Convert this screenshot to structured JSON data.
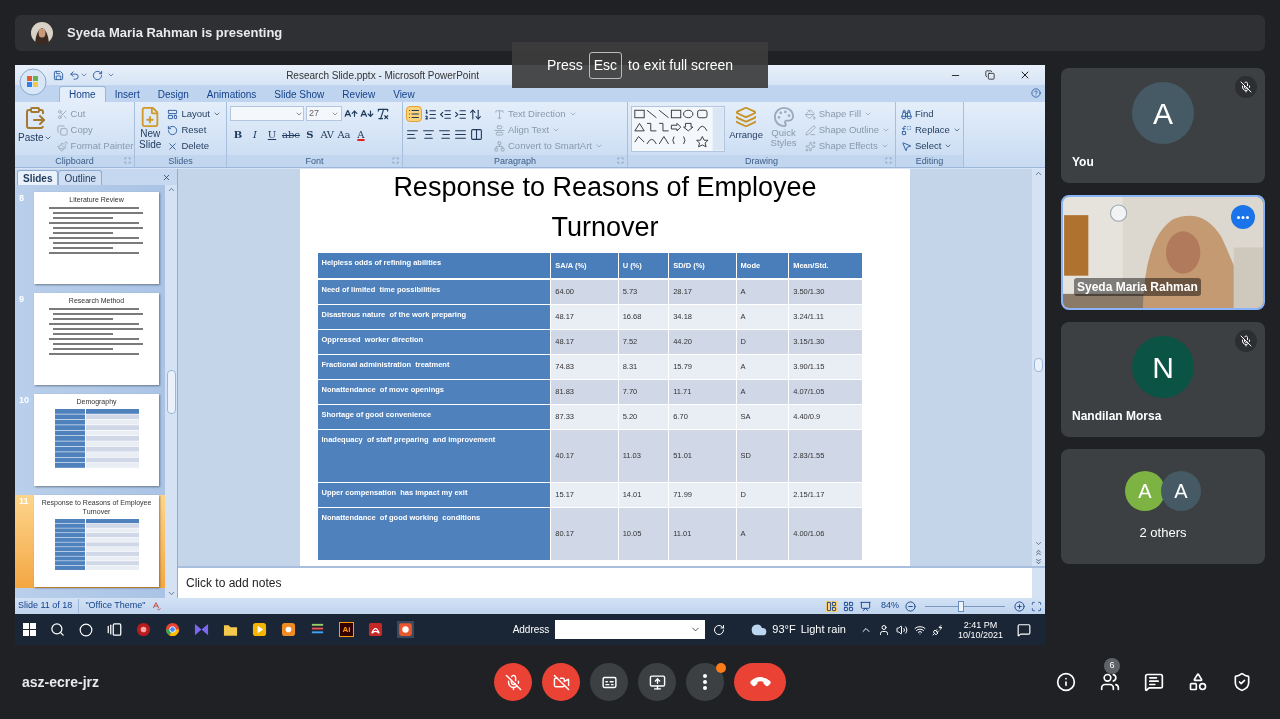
{
  "presenting_banner": {
    "text": "Syeda Maria Rahman is presenting"
  },
  "fullscreen_hint": {
    "before": "Press",
    "key": "Esc",
    "after": "to exit full screen"
  },
  "powerpoint": {
    "title": "Research Slide.pptx - Microsoft PowerPoint",
    "ribbon_tabs": [
      {
        "label": "Home",
        "selected": true
      },
      {
        "label": "Insert",
        "selected": false
      },
      {
        "label": "Design",
        "selected": false
      },
      {
        "label": "Animations",
        "selected": false
      },
      {
        "label": "Slide Show",
        "selected": false
      },
      {
        "label": "Review",
        "selected": false
      },
      {
        "label": "View",
        "selected": false
      }
    ],
    "clipboard": {
      "label": "Clipboard",
      "paste": "Paste",
      "items": [
        {
          "label": "Cut",
          "disabled": true
        },
        {
          "label": "Copy",
          "disabled": true
        },
        {
          "label": "Format Painter",
          "disabled": true
        }
      ]
    },
    "slides_group": {
      "label": "Slides",
      "new_slide": "New Slide",
      "items": [
        {
          "label": "Layout",
          "disabled": false
        },
        {
          "label": "Reset",
          "disabled": false
        },
        {
          "label": "Delete",
          "disabled": false
        }
      ]
    },
    "font": {
      "label": "Font",
      "size": "27",
      "format_buttons": [
        "B",
        "I",
        "U",
        "abc",
        "S",
        "AV",
        "Aa",
        "A"
      ]
    },
    "paragraph": {
      "label": "Paragraph",
      "bullets_on": true,
      "items": [
        {
          "label": "Text Direction",
          "disabled": true
        },
        {
          "label": "Align Text",
          "disabled": true
        },
        {
          "label": "Convert to SmartArt",
          "disabled": true
        }
      ]
    },
    "drawing": {
      "label": "Drawing",
      "arrange": "Arrange",
      "quick_styles": "Quick Styles",
      "quick_styles_disabled": true,
      "items": [
        {
          "label": "Shape Fill",
          "disabled": true
        },
        {
          "label": "Shape Outline",
          "disabled": true
        },
        {
          "label": "Shape Effects",
          "disabled": true
        }
      ]
    },
    "editing": {
      "label": "Editing",
      "items": [
        {
          "label": "Find",
          "disabled": false
        },
        {
          "label": "Replace",
          "disabled": false
        },
        {
          "label": "Select",
          "disabled": false
        }
      ]
    },
    "slide_panel": {
      "tabs": [
        {
          "label": "Slides",
          "selected": true
        },
        {
          "label": "Outline",
          "selected": false
        }
      ],
      "thumbnails": [
        {
          "number": "8",
          "title": "Literature Review",
          "kind": "bullets",
          "selected": false
        },
        {
          "number": "9",
          "title": "Research Method",
          "kind": "bullets",
          "selected": false
        },
        {
          "number": "10",
          "title": "Demography",
          "kind": "table",
          "selected": false
        },
        {
          "number": "11",
          "title": "Response to Reasons of Employee Turnover",
          "kind": "table",
          "selected": true
        }
      ]
    },
    "slide": {
      "title": "Response to Reasons of Employee Turnover",
      "table": {
        "columns": [
          "Helpless odds of refining abilities",
          "SA/A (%)",
          "U (%)",
          "SD/D (%)",
          "Mode",
          "Mean/Std."
        ],
        "rows": [
          [
            "Need of limited  time possibilities",
            "64.00",
            "5.73",
            "28.17",
            "A",
            "3.50/1.30"
          ],
          [
            "Disastrous nature  of the work preparing",
            "48.17",
            "16.68",
            "34.18",
            "A",
            "3.24/1.11"
          ],
          [
            "Oppressed  worker direction",
            "48.17",
            "7.52",
            "44.20",
            "D",
            "3.15/1.30"
          ],
          [
            "Fractional administration  treatment",
            "74.83",
            "8.31",
            "15.79",
            "A",
            "3.90/1.15"
          ],
          [
            "Nonattendance  of move openings",
            "81.83",
            "7.70",
            "11.71",
            "A",
            "4.07/1.05"
          ],
          [
            "Shortage of good convenience",
            "87.33",
            "5.20",
            "6.70",
            "SA",
            "4.40/0.9"
          ],
          [
            "Inadequacy  of staff preparing  and improvement",
            "40.17",
            "11.03",
            "51.01",
            "SD",
            "2.83/1.55"
          ],
          [
            "Upper compensation  has impact my exit",
            "15.17",
            "14.01",
            "71.99",
            "D",
            "2.15/1.17"
          ],
          [
            "Nonattendance  of good working  conditions",
            "80.17",
            "10.05",
            "11.01",
            "A",
            "4.00/1.06"
          ]
        ]
      }
    },
    "notes": {
      "placeholder": "Click to add notes"
    },
    "status_bar": {
      "slide": "Slide 11 of 18",
      "theme": "\"Office Theme\"",
      "zoom": "84%",
      "zoom_slider": {
        "level": 0.45
      }
    }
  },
  "taskbar": {
    "illustrator_label": "Ai",
    "address_label": "Address",
    "weather": "93°F",
    "weather_text": "Light rain",
    "time": "2:41 PM",
    "date": "10/10/2021"
  },
  "participants": [
    {
      "kind": "avatar",
      "name": "You",
      "initial": "A",
      "color": "#455a64",
      "muted": true,
      "highlighted": false
    },
    {
      "kind": "video",
      "name": "Syeda Maria Rahman",
      "muted": false,
      "highlighted": true
    },
    {
      "kind": "avatar",
      "name": "Nandilan Morsa",
      "initial": "N",
      "color": "#0b5345",
      "muted": true,
      "highlighted": false
    },
    {
      "kind": "others",
      "label": "2 others",
      "avatars": [
        {
          "initial": "A",
          "color": "#7cb342"
        },
        {
          "initial": "A",
          "color": "#455a64"
        }
      ],
      "muted": false,
      "highlighted": false
    }
  ],
  "meeting": {
    "code": "asz-ecre-jrz",
    "mic_on": false,
    "camera_on": false,
    "more_alert": true,
    "people_count": "6"
  }
}
